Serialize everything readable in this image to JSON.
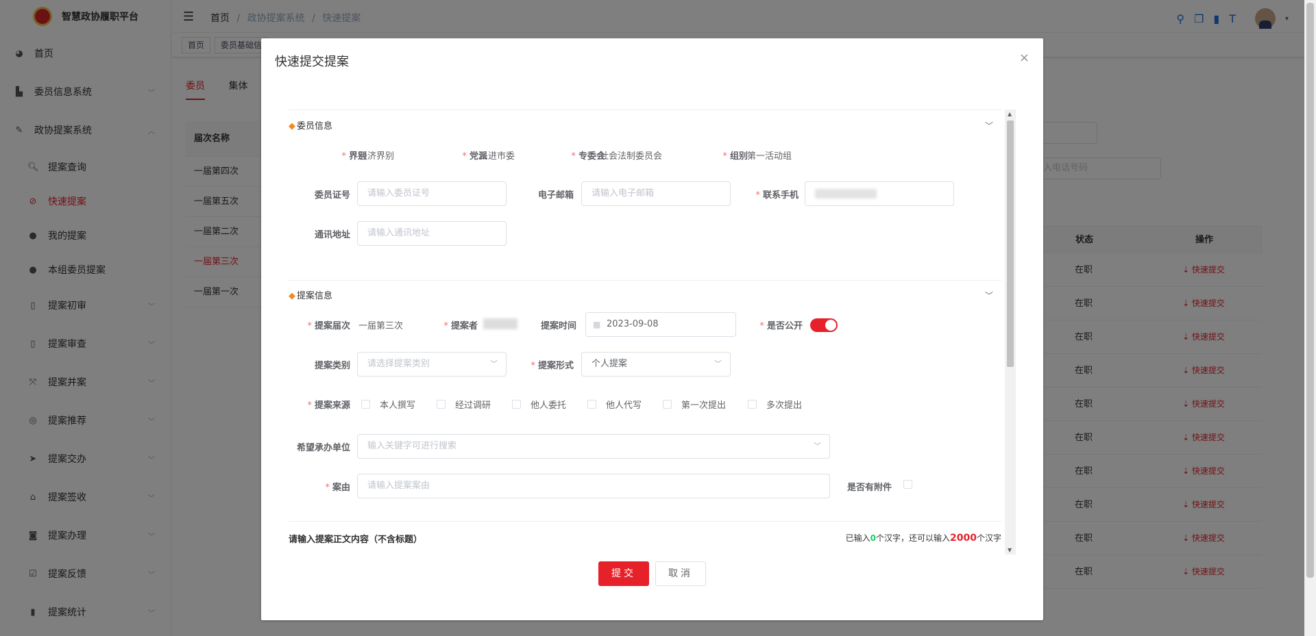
{
  "app": {
    "title": "智慧政协履职平台"
  },
  "sidebar": {
    "items": [
      {
        "label": "首页",
        "icon": "dashboard-icon"
      },
      {
        "label": "委员信息系统",
        "icon": "book-icon"
      },
      {
        "label": "政协提案系统",
        "icon": "edit-icon"
      },
      {
        "label": "提案查询",
        "icon": "search-icon"
      },
      {
        "label": "快速提案",
        "icon": "bolt-icon"
      },
      {
        "label": "我的提案",
        "icon": "user-icon"
      },
      {
        "label": "本组委员提案",
        "icon": "users-icon"
      },
      {
        "label": "提案初审",
        "icon": "open-book-icon"
      },
      {
        "label": "提案审查",
        "icon": "open-book-icon"
      },
      {
        "label": "提案并案",
        "icon": "merge-icon"
      },
      {
        "label": "提案推荐",
        "icon": "recommend-icon"
      },
      {
        "label": "提案交办",
        "icon": "send-icon"
      },
      {
        "label": "提案签收",
        "icon": "inbox-icon"
      },
      {
        "label": "提案办理",
        "icon": "process-icon"
      },
      {
        "label": "提案反馈",
        "icon": "feedback-icon"
      },
      {
        "label": "提案统计",
        "icon": "chart-icon"
      }
    ]
  },
  "header": {
    "breadcrumb": [
      "首页",
      "政协提案系统",
      "快速提案"
    ],
    "separator": "/"
  },
  "tagsview": {
    "tags": [
      "首页",
      "委员基础信"
    ]
  },
  "background": {
    "tabs": [
      "委员",
      "集体"
    ],
    "table_header": "届次名称",
    "rows": [
      "一届第四次",
      "一届第五次",
      "一届第二次",
      "一届第三次",
      "一届第一次"
    ],
    "phone_placeholder": "入电话号码",
    "status_header": "状态",
    "action_header": "操作",
    "status_values": [
      "在职",
      "在职",
      "在职",
      "在职",
      "在职",
      "在职",
      "在职",
      "在职",
      "在职",
      "在职"
    ],
    "action_label": "⇣ 快速提交"
  },
  "dialog": {
    "title": "快速提交提案",
    "close": "×",
    "member_section": "委员信息",
    "jiebie_label": "界别",
    "jiebie_value": "经济界别",
    "dangpai_label": "党派",
    "dangpai_value": "民进市委",
    "zhuanweihui_label": "专委会",
    "zhuanweihui_value": "社会法制委员会",
    "zubie_label": "组别",
    "zubie_value": "第一活动组",
    "cert_label": "委员证号",
    "cert_placeholder": "请输入委员证号",
    "email_label": "电子邮箱",
    "email_placeholder": "请输入电子邮箱",
    "phone_label": "联系手机",
    "address_label": "通讯地址",
    "address_placeholder": "请输入通讯地址",
    "proposal_section": "提案信息",
    "session_label": "提案届次",
    "session_value": "一届第三次",
    "proposer_label": "提案者",
    "time_label": "提案时间",
    "time_value": "2023-09-08",
    "public_label": "是否公开",
    "category_label": "提案类别",
    "category_placeholder": "请选择提案类别",
    "form_label": "提案形式",
    "form_value": "个人提案",
    "source_label": "提案来源",
    "sources": [
      "本人撰写",
      "经过调研",
      "他人委托",
      "他人代写",
      "第一次提出",
      "多次提出"
    ],
    "unit_label": "希望承办单位",
    "unit_placeholder": "输入关键字可进行搜索",
    "reason_label": "案由",
    "reason_placeholder": "请输入提案案由",
    "attach_label": "是否有附件",
    "body_label": "请输入提案正文内容（不含标题）",
    "count_pre": "已输入",
    "count_now": "0",
    "count_mid": "个汉字，还可以输入",
    "count_left": "2000",
    "count_post": "个汉字",
    "submit": "提交",
    "cancel": "取消"
  }
}
